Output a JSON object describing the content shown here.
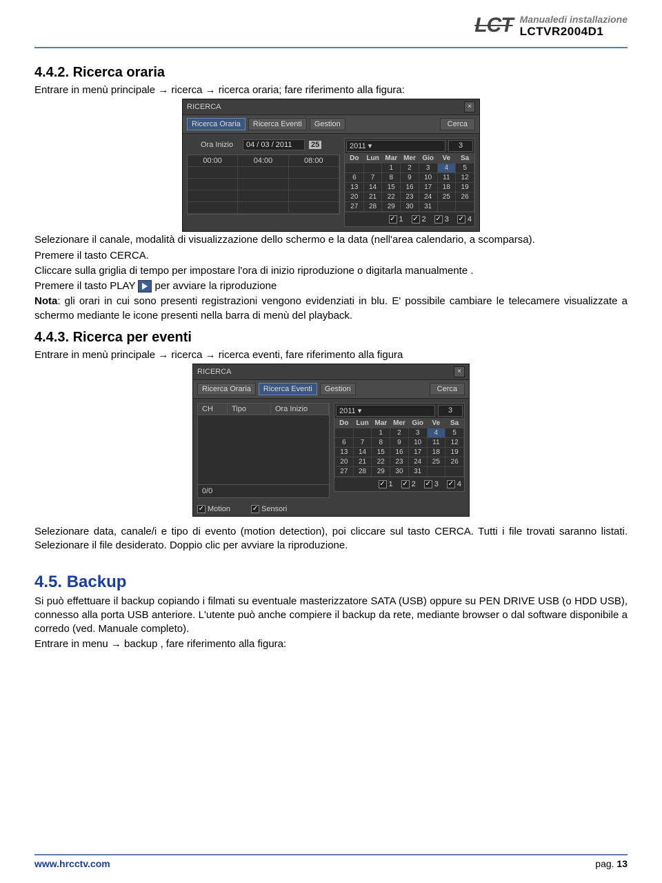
{
  "header": {
    "brand": "LCT",
    "line1": "Manualedi installazione",
    "line2": "LCTVR2004D1"
  },
  "s442": {
    "title": "4.4.2. Ricerca oraria",
    "p1": "Entrare in menù principale →  ricerca → ricerca oraria; fare riferimento alla figura:",
    "p2": "Selezionare il canale, modalità di visualizzazione dello schermo e la data (nell'area calendario, a scomparsa).",
    "p3": "Premere il tasto CERCA.",
    "p4": "Cliccare sulla griglia di tempo per impostare l'ora di inizio riproduzione o digitarla manualmente .",
    "p5a": "Premere il tasto PLAY ",
    "p5b": " per avviare la riproduzione",
    "nota_label": "Nota",
    "nota": ": gli orari in cui sono presenti registrazioni vengono evidenziati in blu.   E' possibile cambiare le telecamere visualizzate a schermo mediante le icone presenti nella barra di menù del playback."
  },
  "ricerca1": {
    "title": "RICERCA",
    "tabs": [
      "Ricerca Oraria",
      "Ricerca Eventi",
      "Gestion"
    ],
    "cerca": "Cerca",
    "ora_inizio": "Ora Inizio",
    "date_value": "04 / 03 / 2011",
    "time_headers": [
      "00:00",
      "04:00",
      "08:00"
    ],
    "year": "2011",
    "month": "3",
    "days": [
      "Do",
      "Lun",
      "Mar",
      "Mer",
      "Gio",
      "Ve",
      "Sa"
    ],
    "weeks": [
      [
        "",
        "",
        "1",
        "2",
        "3",
        "4",
        "5"
      ],
      [
        "6",
        "7",
        "8",
        "9",
        "10",
        "11",
        "12"
      ],
      [
        "13",
        "14",
        "15",
        "16",
        "17",
        "18",
        "19"
      ],
      [
        "20",
        "21",
        "22",
        "23",
        "24",
        "25",
        "26"
      ],
      [
        "27",
        "28",
        "29",
        "30",
        "31",
        "",
        ""
      ]
    ],
    "channels": [
      "1",
      "2",
      "3",
      "4"
    ]
  },
  "s443": {
    "title": "4.4.3. Ricerca per eventi",
    "p1": "Entrare in menù principale →  ricerca → ricerca eventi, fare riferimento alla figura",
    "p2": "Selezionare data, canale/i  e  tipo di evento (motion detection), poi cliccare sul tasto CERCA. Tutti i file trovati saranno listati.  Selezionare il file desiderato. Doppio clic per avviare la riproduzione."
  },
  "ricerca2": {
    "title": "RICERCA",
    "tabs": [
      "Ricerca Oraria",
      "Ricerca Eventi",
      "Gestion"
    ],
    "cerca": "Cerca",
    "cols": [
      "CH",
      "Tipo",
      "Ora Inizio"
    ],
    "zero": "0/0",
    "motion": "Motion",
    "sensori": "Sensori"
  },
  "s45": {
    "title": "4.5. Backup",
    "p1": "Si può effettuare il backup copiando i filmati su eventuale masterizzatore SATA (USB) oppure su PEN DRIVE USB (o HDD USB), connesso alla porta USB anteriore. L'utente può anche compiere il backup da rete, mediante browser o dal software disponibile a corredo (ved. Manuale completo).",
    "p2": "Entrare in menu → backup , fare riferimento alla figura:"
  },
  "footer": {
    "site": "www.hrcctv.com",
    "pg_label": "pag. ",
    "pg_num": "13"
  }
}
